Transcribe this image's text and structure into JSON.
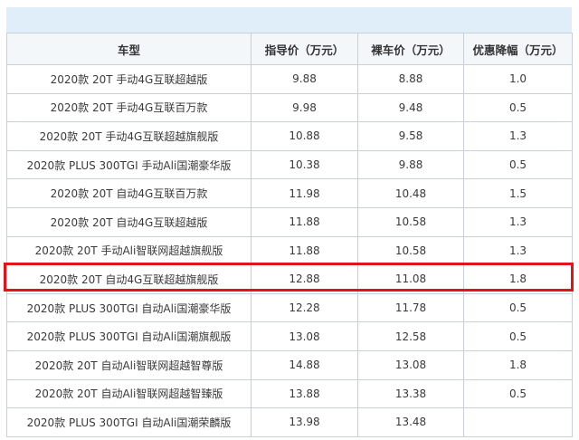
{
  "table": {
    "headers": [
      "车型",
      "指导价（万元）",
      "裸车价（万元）",
      "优惠降幅（万元）"
    ],
    "rows": [
      [
        "2020款 20T 手动4G互联超越版",
        "9.88",
        "8.88",
        "1.0"
      ],
      [
        "2020款 20T 手动4G互联百万款",
        "9.98",
        "9.48",
        "0.5"
      ],
      [
        "2020款 20T 手动4G互联超越旗舰版",
        "10.88",
        "9.58",
        "1.3"
      ],
      [
        "2020款 PLUS 300TGI 手动Ali国潮豪华版",
        "10.38",
        "9.88",
        "0.5"
      ],
      [
        "2020款 20T 自动4G互联百万款",
        "11.98",
        "10.48",
        "1.5"
      ],
      [
        "2020款 20T 自动4G互联超越版",
        "11.88",
        "10.58",
        "1.3"
      ],
      [
        "2020款 20T 手动Ali智联网超越旗舰版",
        "11.88",
        "10.58",
        "1.3"
      ],
      [
        "2020款 20T 自动4G互联超越旗舰版",
        "12.88",
        "11.08",
        "1.8"
      ],
      [
        "2020款 PLUS 300TGI 自动Ali国潮豪华版",
        "12.28",
        "11.78",
        "0.5"
      ],
      [
        "2020款 PLUS 300TGI 自动Ali国潮旗舰版",
        "13.08",
        "12.58",
        "0.5"
      ],
      [
        "2020款 20T 自动Ali智联网超越智尊版",
        "14.88",
        "13.08",
        "1.8"
      ],
      [
        "2020款 20T 自动Ali智联网超越智臻版",
        "13.88",
        "13.38",
        "0.5"
      ],
      [
        "2020款 PLUS 300TGI 自动Ali国潮荣麟版",
        "13.98",
        "13.48",
        ""
      ]
    ],
    "highlighted_row": 7,
    "highlight_color": "#e0141e",
    "header_band_color": "#dfeef9"
  }
}
